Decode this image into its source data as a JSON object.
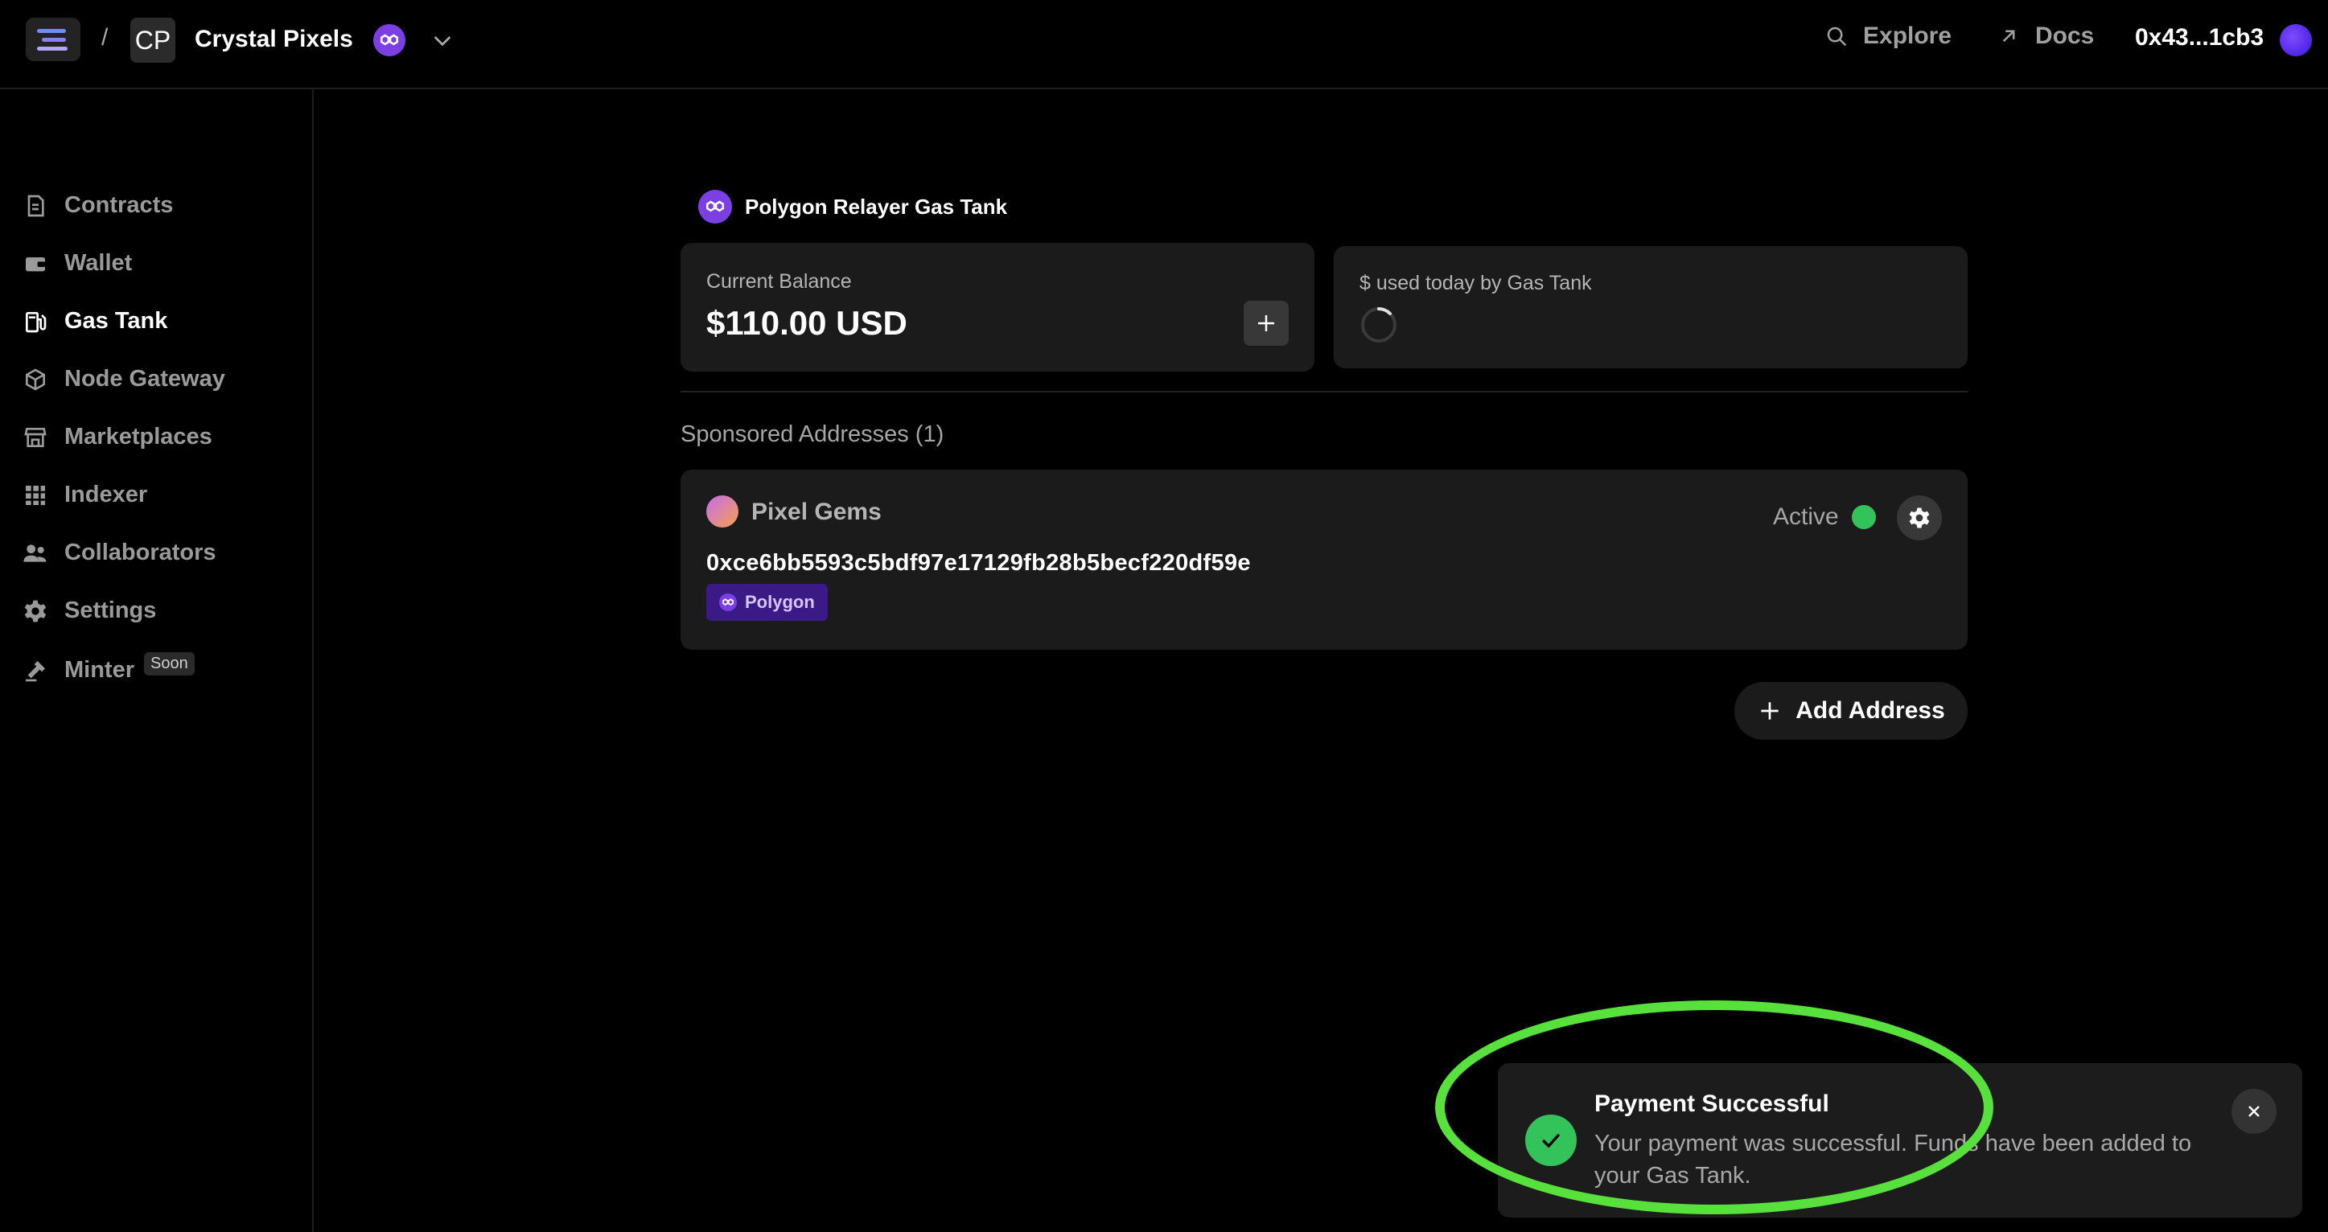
{
  "header": {
    "project_initials": "CP",
    "project_name": "Crystal Pixels",
    "breadcrumb_separator": "/",
    "explore_label": "Explore",
    "docs_label": "Docs",
    "wallet_address": "0x43...1cb3"
  },
  "sidebar": {
    "items": [
      {
        "label": "Contracts",
        "icon": "contracts-icon"
      },
      {
        "label": "Wallet",
        "icon": "wallet-icon"
      },
      {
        "label": "Gas Tank",
        "icon": "gas-pump-icon",
        "active": true
      },
      {
        "label": "Node Gateway",
        "icon": "cube-icon"
      },
      {
        "label": "Marketplaces",
        "icon": "storefront-icon"
      },
      {
        "label": "Indexer",
        "icon": "grid-icon"
      },
      {
        "label": "Collaborators",
        "icon": "users-icon"
      },
      {
        "label": "Settings",
        "icon": "gear-icon"
      },
      {
        "label": "Minter",
        "icon": "hammer-icon",
        "badge": "Soon"
      }
    ]
  },
  "gas_tank": {
    "title": "Polygon Relayer Gas Tank",
    "balance_label": "Current Balance",
    "balance_value": "$110.00 USD",
    "usage_label": "$ used today by Gas Tank",
    "sponsored_heading": "Sponsored Addresses (1)",
    "sponsored": [
      {
        "name": "Pixel Gems",
        "address": "0xce6bb5593c5bdf97e17129fb28b5becf220df59e",
        "chain": "Polygon",
        "status": "Active"
      }
    ],
    "add_address_label": "Add Address"
  },
  "toast": {
    "title": "Payment Successful",
    "message": "Your payment was successful. Funds have been added to your Gas Tank."
  },
  "colors": {
    "polygon_purple": "#7b3fe4",
    "success_green": "#34c25a",
    "highlight_green": "#58e03c"
  }
}
